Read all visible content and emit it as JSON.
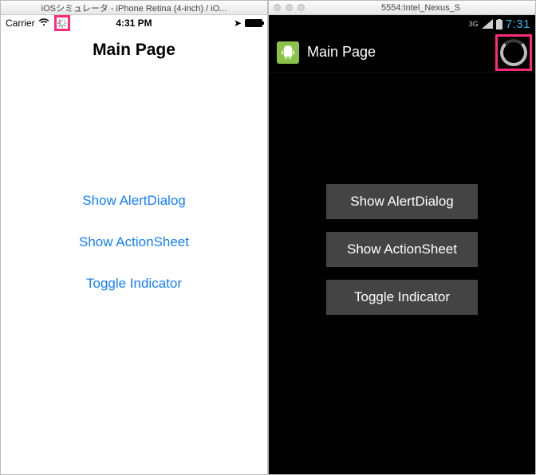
{
  "ios": {
    "window_title": "iOSシミュレータ - iPhone Retina (4-inch) / iO...",
    "status": {
      "carrier": "Carrier",
      "time": "4:31 PM"
    },
    "nav_title": "Main Page",
    "buttons": {
      "alert": "Show AlertDialog",
      "actionsheet": "Show ActionSheet",
      "toggle": "Toggle Indicator"
    }
  },
  "android": {
    "window_title": "5554:Intel_Nexus_S",
    "status": {
      "network": "3G",
      "time": "7:31"
    },
    "nav_title": "Main Page",
    "buttons": {
      "alert": "Show AlertDialog",
      "actionsheet": "Show ActionSheet",
      "toggle": "Toggle Indicator"
    }
  }
}
